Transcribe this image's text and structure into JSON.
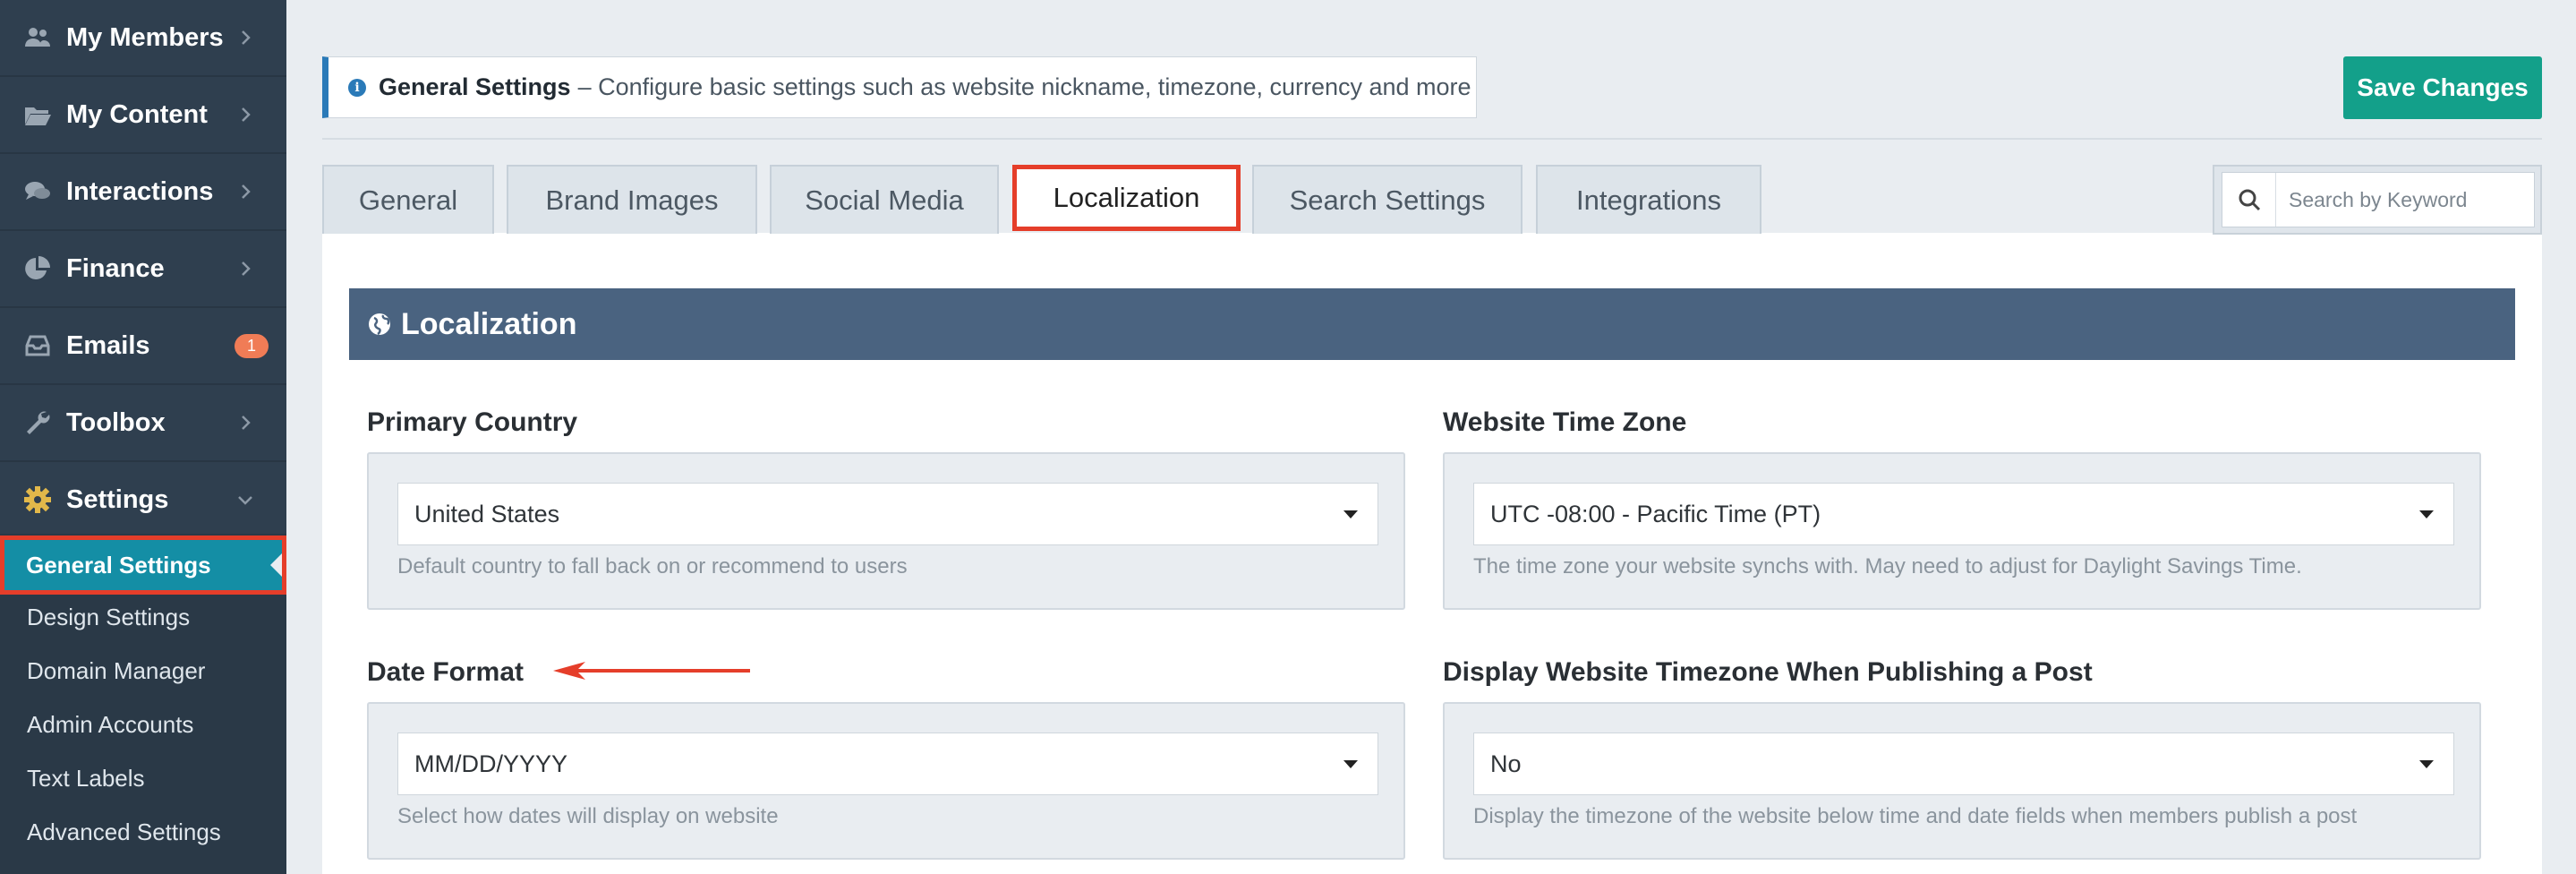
{
  "sidebar": {
    "items": [
      {
        "label": "My Members",
        "icon": "users-icon"
      },
      {
        "label": "My Content",
        "icon": "folder-open-icon"
      },
      {
        "label": "Interactions",
        "icon": "comments-icon"
      },
      {
        "label": "Finance",
        "icon": "pie-chart-icon"
      },
      {
        "label": "Emails",
        "icon": "inbox-icon",
        "badge": "1"
      },
      {
        "label": "Toolbox",
        "icon": "wrench-icon"
      },
      {
        "label": "Settings",
        "icon": "gear-icon"
      }
    ],
    "submenu": [
      {
        "label": "General Settings",
        "active": true
      },
      {
        "label": "Design Settings"
      },
      {
        "label": "Domain Manager"
      },
      {
        "label": "Admin Accounts"
      },
      {
        "label": "Text Labels"
      },
      {
        "label": "Advanced Settings"
      }
    ]
  },
  "header": {
    "info_title": "General Settings",
    "info_text": "– Configure basic settings such as website nickname, timezone, currency and more",
    "save_label": "Save Changes"
  },
  "tabs": [
    "General",
    "Brand Images",
    "Social Media",
    "Localization",
    "Search Settings",
    "Integrations"
  ],
  "active_tab": "Localization",
  "search": {
    "placeholder": "Search by Keyword"
  },
  "section": {
    "title": "Localization"
  },
  "fields": {
    "primary_country": {
      "label": "Primary Country",
      "value": "United States",
      "help": "Default country to fall back on or recommend to users"
    },
    "time_zone": {
      "label": "Website Time Zone",
      "value": "UTC -08:00 - Pacific Time (PT)",
      "help": "The time zone your website synchs with. May need to adjust for Daylight Savings Time."
    },
    "date_format": {
      "label": "Date Format",
      "value": "MM/DD/YYYY",
      "help": "Select how dates will display on website"
    },
    "display_timezone": {
      "label": "Display Website Timezone When Publishing a Post",
      "value": "No",
      "help": "Display the timezone of the website below time and date fields when members publish a post"
    }
  },
  "colors": {
    "sidebar_bg": "#2f3f4f",
    "active_sub": "#148ea5",
    "save_button": "#13a08a",
    "section_header": "#4a6380",
    "highlight": "#e53e2a",
    "badge": "#f07c56"
  }
}
